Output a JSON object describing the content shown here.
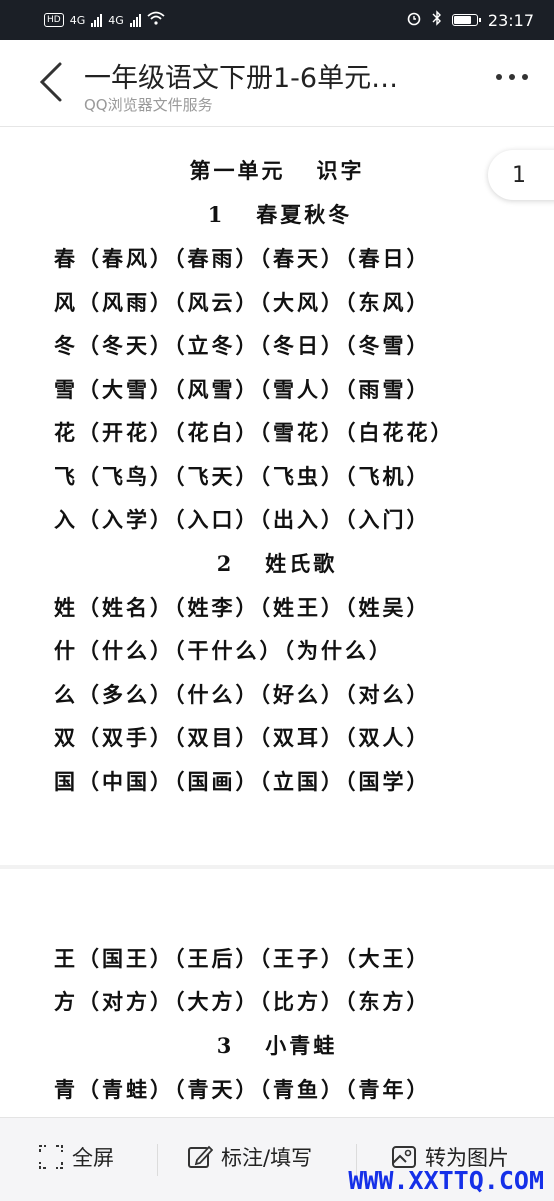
{
  "status_bar": {
    "network_badge": "HD",
    "signal1": "4G",
    "signal2": "4G",
    "time": "23:17",
    "battery_level": 0.8
  },
  "header": {
    "title": "一年级语文下册1-6单元…",
    "subtitle": "QQ浏览器文件服务"
  },
  "page_indicator": "1",
  "document": {
    "unit_title": "第一单元   识字",
    "lesson1_title": "1   春夏秋冬",
    "lesson1_lines": [
      "春（春风）（春雨）（春天）（春日）",
      "风（风雨）（风云）（大风）（东风）",
      "冬（冬天）（立冬）（冬日）（冬雪）",
      "雪（大雪）（风雪）（雪人）（雨雪）",
      "花（开花）（花白）（雪花）（白花花）",
      "飞（飞鸟）（飞天）（飞虫）（飞机）",
      "入（入学）（入口）（出入）（入门）"
    ],
    "lesson2_title": "2   姓氏歌",
    "lesson2_lines": [
      "姓（姓名）（姓李）（姓王）（姓吴）",
      "什（什么）（干什么）（为什么）",
      "么（多么）（什么）（好么）（对么）",
      "双（双手）（双目）（双耳）（双人）",
      "国（中国）（国画）（立国）（国学）"
    ],
    "page2_lines": [
      "王（国王）（王后）（王子）（大王）",
      "方（对方）（大方）（比方）（东方）"
    ],
    "lesson3_title": "3   小青蛙",
    "lesson3_lines": [
      "青（青蛙）（青天）（青鱼）（青年）"
    ]
  },
  "toolbar": {
    "fullscreen_label": "全屏",
    "annotate_label": "标注/填写",
    "to_image_label": "转为图片"
  },
  "watermark": "WWW.XXTTQ.COM",
  "colors": {
    "status_bar_bg": "#1b1f26",
    "watermark": "#1530e8",
    "page_gap": "#f2f2f2"
  }
}
